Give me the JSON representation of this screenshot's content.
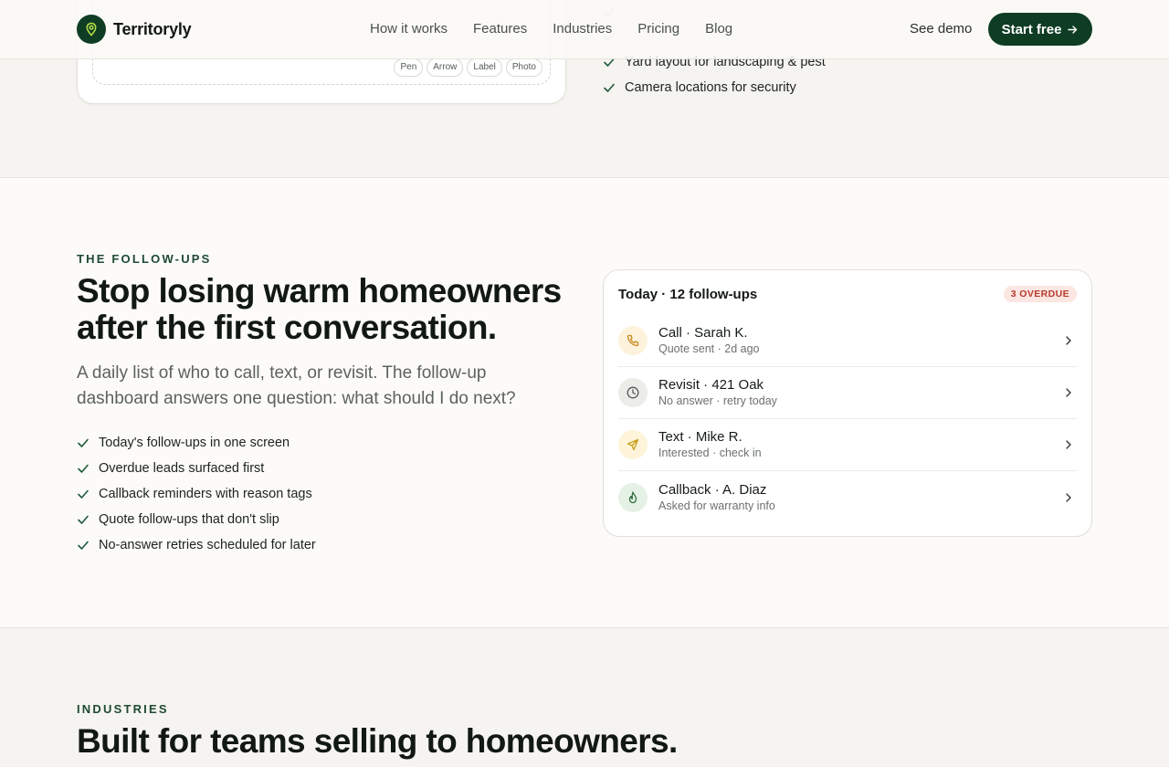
{
  "nav": {
    "brand": "Territoryly",
    "links": [
      "How it works",
      "Features",
      "Industries",
      "Pricing",
      "Blog"
    ],
    "see_demo": "See demo",
    "start_free": "Start free"
  },
  "top_section": {
    "tools": [
      "Pen",
      "Arrow",
      "Label",
      "Photo"
    ],
    "checks": [
      "Yard layout for landscaping & pest",
      "Camera locations for security"
    ]
  },
  "followups": {
    "eyebrow": "THE FOLLOW-UPS",
    "heading": "Stop losing warm homeowners after the first conversation.",
    "lead": "A daily list of who to call, text, or revisit. The follow-up dashboard answers one question: what should I do next?",
    "checks": [
      "Today's follow-ups in one screen",
      "Overdue leads surfaced first",
      "Callback reminders with reason tags",
      "Quote follow-ups that don't slip",
      "No-answer retries scheduled for later"
    ],
    "card": {
      "title": "Today · 12 follow-ups",
      "badge": "3 OVERDUE",
      "items": [
        {
          "name": "Call · Sarah K.",
          "sub": "Quote sent · 2d ago",
          "icon": "phone-icon"
        },
        {
          "name": "Revisit · 421 Oak",
          "sub": "No answer · retry today",
          "icon": "clock-icon"
        },
        {
          "name": "Text · Mike R.",
          "sub": "Interested · check in",
          "icon": "send-icon"
        },
        {
          "name": "Callback · A. Diaz",
          "sub": "Asked for warranty info",
          "icon": "flame-icon"
        }
      ]
    }
  },
  "industries": {
    "eyebrow": "INDUSTRIES",
    "heading": "Built for teams selling to homeowners."
  },
  "colors": {
    "brand": "#0f3d24",
    "overdue": "#b53a2c"
  }
}
